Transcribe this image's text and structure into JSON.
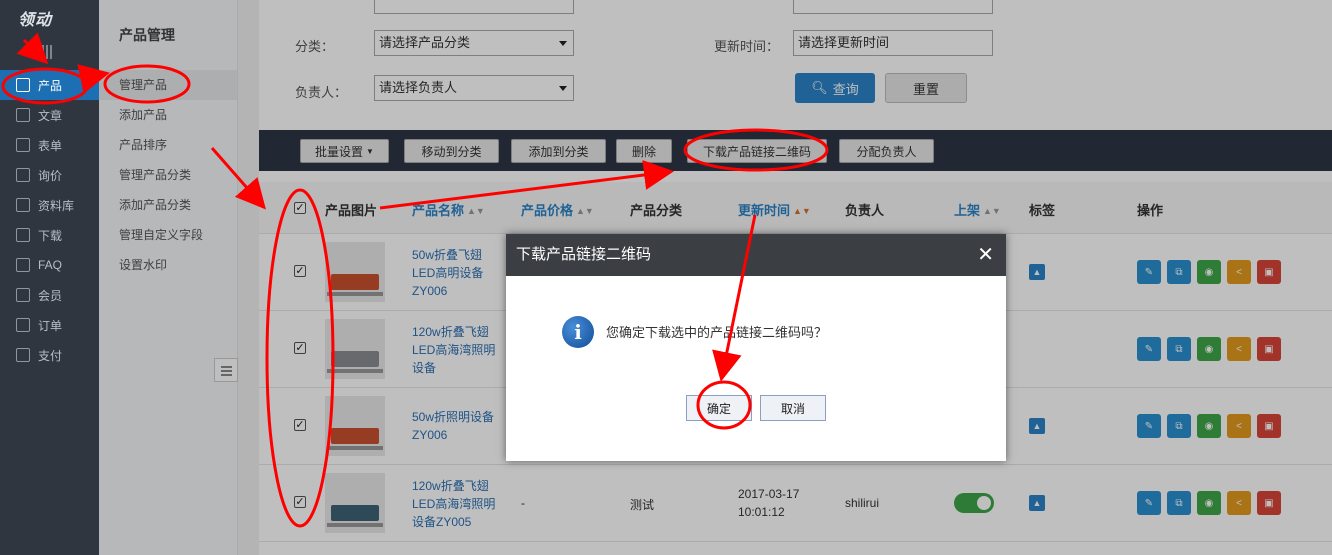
{
  "nav": {
    "logo": "领动",
    "items": [
      {
        "label": "产品",
        "icon": "grid-icon"
      },
      {
        "label": "文章",
        "icon": "article-icon"
      },
      {
        "label": "表单",
        "icon": "form-icon"
      },
      {
        "label": "询价",
        "icon": "inquiry-icon"
      },
      {
        "label": "资料库",
        "icon": "library-icon"
      },
      {
        "label": "下载",
        "icon": "download-icon"
      },
      {
        "label": "FAQ",
        "icon": "faq-icon"
      },
      {
        "label": "会员",
        "icon": "member-icon"
      },
      {
        "label": "订单",
        "icon": "order-icon"
      },
      {
        "label": "支付",
        "icon": "payment-icon"
      }
    ]
  },
  "subnav": {
    "title": "产品管理",
    "items": [
      "管理产品",
      "添加产品",
      "产品排序",
      "管理产品分类",
      "添加产品分类",
      "管理自定义字段",
      "设置水印"
    ]
  },
  "filters": {
    "category_label": "分类：",
    "category_value": "请选择产品分类",
    "owner_label": "负责人：",
    "owner_value": "请选择负责人",
    "update_label": "更新时间：",
    "update_value": "请选择更新时间",
    "query": "查询",
    "reset": "重置"
  },
  "toolbar": [
    "批量设置",
    "移动到分类",
    "添加到分类",
    "删除",
    "下载产品链接二维码",
    "分配负责人"
  ],
  "table": {
    "headers": [
      "产品图片",
      "产品名称",
      "产品价格",
      "产品分类",
      "更新时间",
      "负责人",
      "上架",
      "标签",
      "操作"
    ],
    "rows": [
      {
        "name": "50w折叠飞翅LED高明设备ZY006",
        "sofa": "#c9502e"
      },
      {
        "name": "120w折叠飞翅LED高海湾照明设备",
        "sofa": "#8a8d92"
      },
      {
        "name": "50w折照明设备ZY006",
        "sofa": "#c9502e"
      },
      {
        "name": "120w折叠飞翅LED高海湾照明设备ZY005",
        "sofa": "#3e6275",
        "price": "-",
        "category": "测试",
        "date": "2017-03-17",
        "time": "10:01:12",
        "owner": "shilirui"
      }
    ]
  },
  "dialog": {
    "title": "下载产品链接二维码",
    "message": "您确定下载选中的产品链接二维码吗？",
    "confirm": "确定",
    "cancel": "取消"
  },
  "colors": {
    "accent": "#2b83c7",
    "annotation": "#ff0000"
  }
}
